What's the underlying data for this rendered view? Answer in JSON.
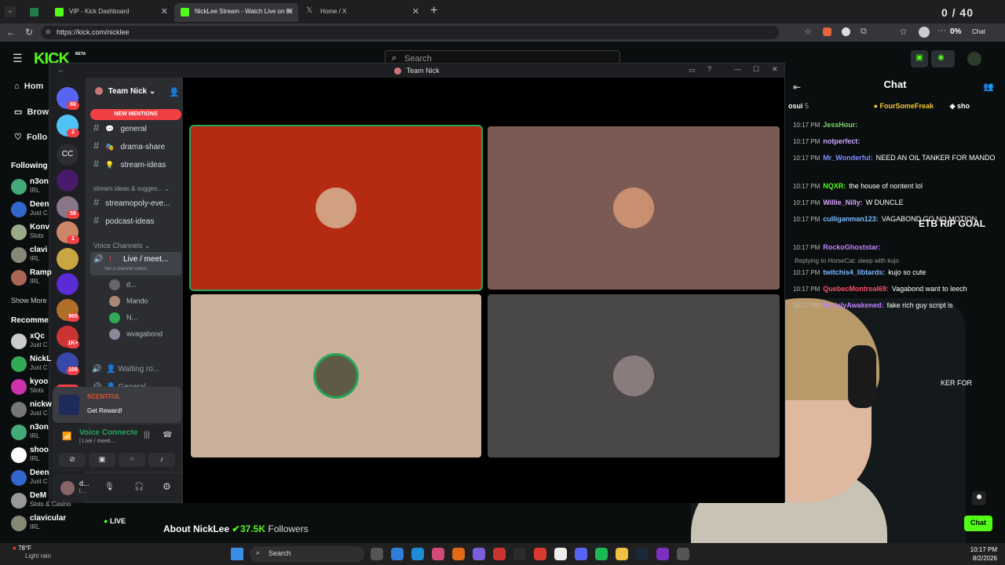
{
  "browser": {
    "tabs": [
      {
        "label": "",
        "color": "#1e7e4a"
      },
      {
        "label": "VIP - Kick Dashboard",
        "color": "#53fc18"
      },
      {
        "label": "NickLee Stream - Watch Live on Ki",
        "color": "#53fc18"
      },
      {
        "label": "Home / X",
        "color": "#444"
      }
    ],
    "url": "https://kick.com/nicklee",
    "overlay_counter": "0 / 40",
    "zoom_badge": "0%",
    "chat_button": "Chat"
  },
  "kick": {
    "logo": "KICK",
    "beta": "BETA",
    "search_placeholder": "Search",
    "nav": [
      {
        "label": "Hom",
        "icon": "home-icon"
      },
      {
        "label": "Brow",
        "icon": "browse-icon"
      },
      {
        "label": "Follo",
        "icon": "heart-icon"
      }
    ],
    "following_header": "Following",
    "following": [
      {
        "name": "n3on",
        "sub": "IRL",
        "color": "#4a7"
      },
      {
        "name": "Deen",
        "sub": "Just C",
        "color": "#36c"
      },
      {
        "name": "Konv",
        "sub": "Slots",
        "color": "#9a8"
      },
      {
        "name": "clavi",
        "sub": "IRL",
        "color": "#887"
      },
      {
        "name": "Ramp",
        "sub": "IRL",
        "color": "#a65"
      }
    ],
    "show_more": "Show More",
    "recommended_header": "Recomme",
    "recommended": [
      {
        "name": "xQc",
        "sub": "Just C",
        "color": "#ccc"
      },
      {
        "name": "NickL",
        "sub": "Just C",
        "color": "#3a5"
      },
      {
        "name": "kyoo",
        "sub": "Slots",
        "color": "#c3a"
      },
      {
        "name": "nickw",
        "sub": "Just C",
        "color": "#777"
      },
      {
        "name": "n3on",
        "sub": "IRL",
        "color": "#4a7"
      },
      {
        "name": "shoo",
        "sub": "IRL",
        "color": "#fff"
      },
      {
        "name": "Deen",
        "sub": "Just C",
        "color": "#36c"
      },
      {
        "name": "DeM",
        "sub": "Slots & Casino",
        "color": "#999"
      },
      {
        "name": "clavicular",
        "sub": "IRL",
        "color": "#887"
      }
    ],
    "live_label": "LIVE",
    "about_label": "About NickLee",
    "followers_count": "37.5K",
    "followers_label": "Followers",
    "chat_title": "Chat",
    "chat_send": "Chat",
    "etb_overlay": "ETB RIP GOAL",
    "pinned": [
      {
        "name": "osui",
        "count": "5"
      },
      {
        "name": "FourSomeFreak",
        "count": ""
      },
      {
        "name": "sho",
        "count": ""
      }
    ],
    "messages": [
      {
        "time": "10:17 PM",
        "user": "JessHour:",
        "text": "",
        "color": "#7fd36b"
      },
      {
        "time": "10:17 PM",
        "user": "notperfect:",
        "text": "",
        "color": "#c7a4ff"
      },
      {
        "time": "10:17 PM",
        "user": "Mr_Wonderful:",
        "text": "NEED AN OIL TANKER FOR MANDO",
        "color": "#7a8cff"
      },
      {
        "time": "10:17 PM",
        "user": "NQXR:",
        "text": "the house of nontent lol",
        "color": "#53fc18"
      },
      {
        "time": "10:17 PM",
        "user": "Willie_Nilly:",
        "text": "W DUNCLE",
        "color": "#d7a0ff"
      },
      {
        "time": "10:17 PM",
        "user": "culliganman123:",
        "text": "VAGABOND GO NO MOTION",
        "color": "#7ab8ff"
      },
      {
        "time": "10:17 PM",
        "user": "RockoGhoststar:",
        "text": "",
        "color": "#c080ff"
      },
      {
        "time": "10:17 PM",
        "user": "twitchis4_libtards:",
        "text": "kujo so cute",
        "color": "#7ab8ff"
      },
      {
        "time": "10:17 PM",
        "user": "QuebecMontreal69:",
        "text": "Vagabond want to leech",
        "color": "#ff4d6a"
      },
      {
        "time": "10:17 PM",
        "user": "RudelyAwakened:",
        "text": "fake rich guy script is",
        "color": "#c080ff"
      }
    ],
    "reply_note": "Replying to HorseCat: sleep with kujo",
    "ghost_text": "KER FOR"
  },
  "discord": {
    "title": "Team Nick",
    "server_name": "Team Nick",
    "new_mentions": "NEW MENTIONS",
    "guild_badges": [
      "86",
      "2",
      "",
      "",
      "58",
      "1",
      "",
      "",
      "965",
      "1K+",
      "106"
    ],
    "cc_label": "CC",
    "new_badge": "NEW",
    "channels": [
      {
        "name": "general",
        "emoji": "💬"
      },
      {
        "name": "drama-share",
        "emoji": "🎭"
      },
      {
        "name": "stream-ideas",
        "emoji": "💡"
      }
    ],
    "category_1": "stream ideas & sugges...",
    "channels_2": [
      {
        "name": "streamopoly-eve..."
      },
      {
        "name": "podcast-ideas"
      }
    ],
    "voice_header": "Voice Channels",
    "voice_channel": "Live / meet...",
    "channel_status": "Set a channel status",
    "voice_users": [
      {
        "name": "d...",
        "color": "#666"
      },
      {
        "name": "Mando",
        "color": "#a87"
      },
      {
        "name": "N...",
        "color": "#3a5"
      },
      {
        "name": "wvagabond",
        "color": "#889"
      }
    ],
    "voice_2": "Waiting ro...",
    "voice_3": "General",
    "reward_title": "SCENTFUL",
    "reward_cta": "Get Reward!",
    "voice_connected": "Voice Connecte",
    "voice_sub": "| Live / meeti...",
    "user_name": "d...",
    "user_sub": "l...",
    "tiles": [
      {
        "color": "#b52b12",
        "avatar": "#d0a080",
        "speaking": true
      },
      {
        "color": "#7a5a52",
        "avatar": "#c89070",
        "speaking": false
      },
      {
        "color": "#c8b09a",
        "avatar": "#5e5a45",
        "speaking": true
      },
      {
        "color": "#4a4748",
        "avatar": "#8a7c7c",
        "speaking": false
      }
    ]
  },
  "taskbar": {
    "weather_temp": "78°F",
    "weather_desc": "Light rain",
    "search": "Search",
    "time": "10:17 PM",
    "date": "8/2/2026"
  }
}
